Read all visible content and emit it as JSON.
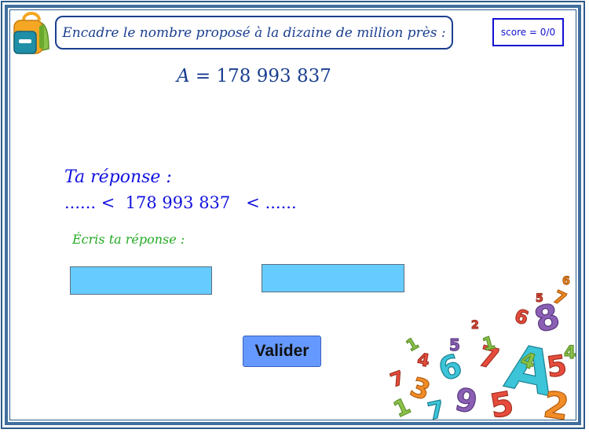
{
  "header": {
    "instruction": "Encadre le nombre proposé à la dizaine de million près :",
    "score": "score = 0/0"
  },
  "problem": {
    "variable": "A",
    "equals": " = ",
    "number": "178 993 837"
  },
  "answer": {
    "title": "Ta réponse :",
    "line": "...... <  178 993 837   < ......",
    "hint": "Écris ta réponse :",
    "lower_value": "",
    "upper_value": ""
  },
  "actions": {
    "validate_label": "Valider"
  },
  "colors": {
    "accent_blue": "#1212e0",
    "navy": "#1b3f8f",
    "hint_green": "#22aa22",
    "input_fill": "#66ccff",
    "button_fill": "#6699ff"
  },
  "icons": [
    "backpack-icon",
    "colorful-numbers-illustration"
  ]
}
